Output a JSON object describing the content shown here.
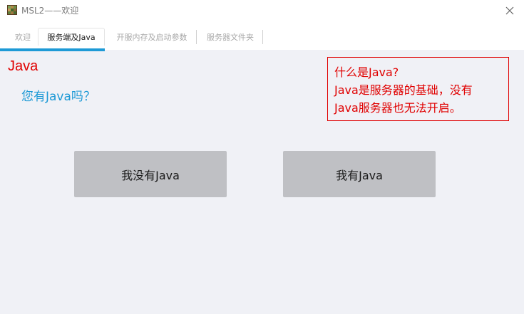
{
  "window": {
    "title": "MSL2——欢迎",
    "icon": "app-grid-icon",
    "close_icon": "close-icon"
  },
  "tabs": [
    {
      "label": "欢迎",
      "active": false
    },
    {
      "label": "服务端及Java",
      "active": true
    },
    {
      "label": "开服内存及启动参数",
      "active": false
    },
    {
      "label": "服务器文件夹",
      "active": false
    }
  ],
  "content": {
    "section_title": "Java",
    "question": "您有Java吗？",
    "info_lines": [
      "什么是Java?",
      "Java是服务器的基础，没有",
      "Java服务器也无法开启。"
    ],
    "buttons": {
      "no_java": "我没有Java",
      "have_java": "我有Java"
    }
  },
  "colors": {
    "accent": "#1e9ad6",
    "warning": "#e00000",
    "button_bg": "#bfc0c4",
    "page_bg": "#f0f1f6"
  }
}
